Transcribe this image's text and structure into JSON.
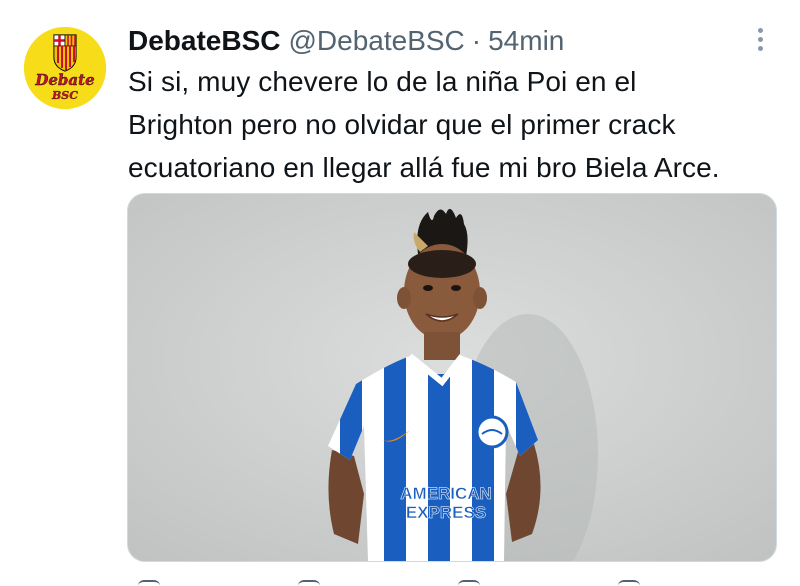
{
  "tweet": {
    "display_name": "DebateBSC",
    "handle": "@DebateBSC",
    "separator": "·",
    "time": "54min",
    "text_lines": [
      "Si si, muy chevere lo de la niña Poi en el",
      "Brighton pero no olvidar que el primer crack",
      "ecuatoriano en llegar allá fue mi bro Biela Arce."
    ]
  },
  "avatar": {
    "logo_top": "Debate",
    "logo_bottom": "BSC",
    "background_color": "#f7dc1a",
    "text_color": "#c8102e"
  },
  "media": {
    "jersey_sponsor_line1": "AMERICAN",
    "jersey_sponsor_line2": "EXPRESS",
    "jersey_stripe_color": "#1a5fbf",
    "background_color": "#d2d4d3"
  },
  "colors": {
    "text_primary": "#0f1419",
    "text_secondary": "#536471"
  }
}
